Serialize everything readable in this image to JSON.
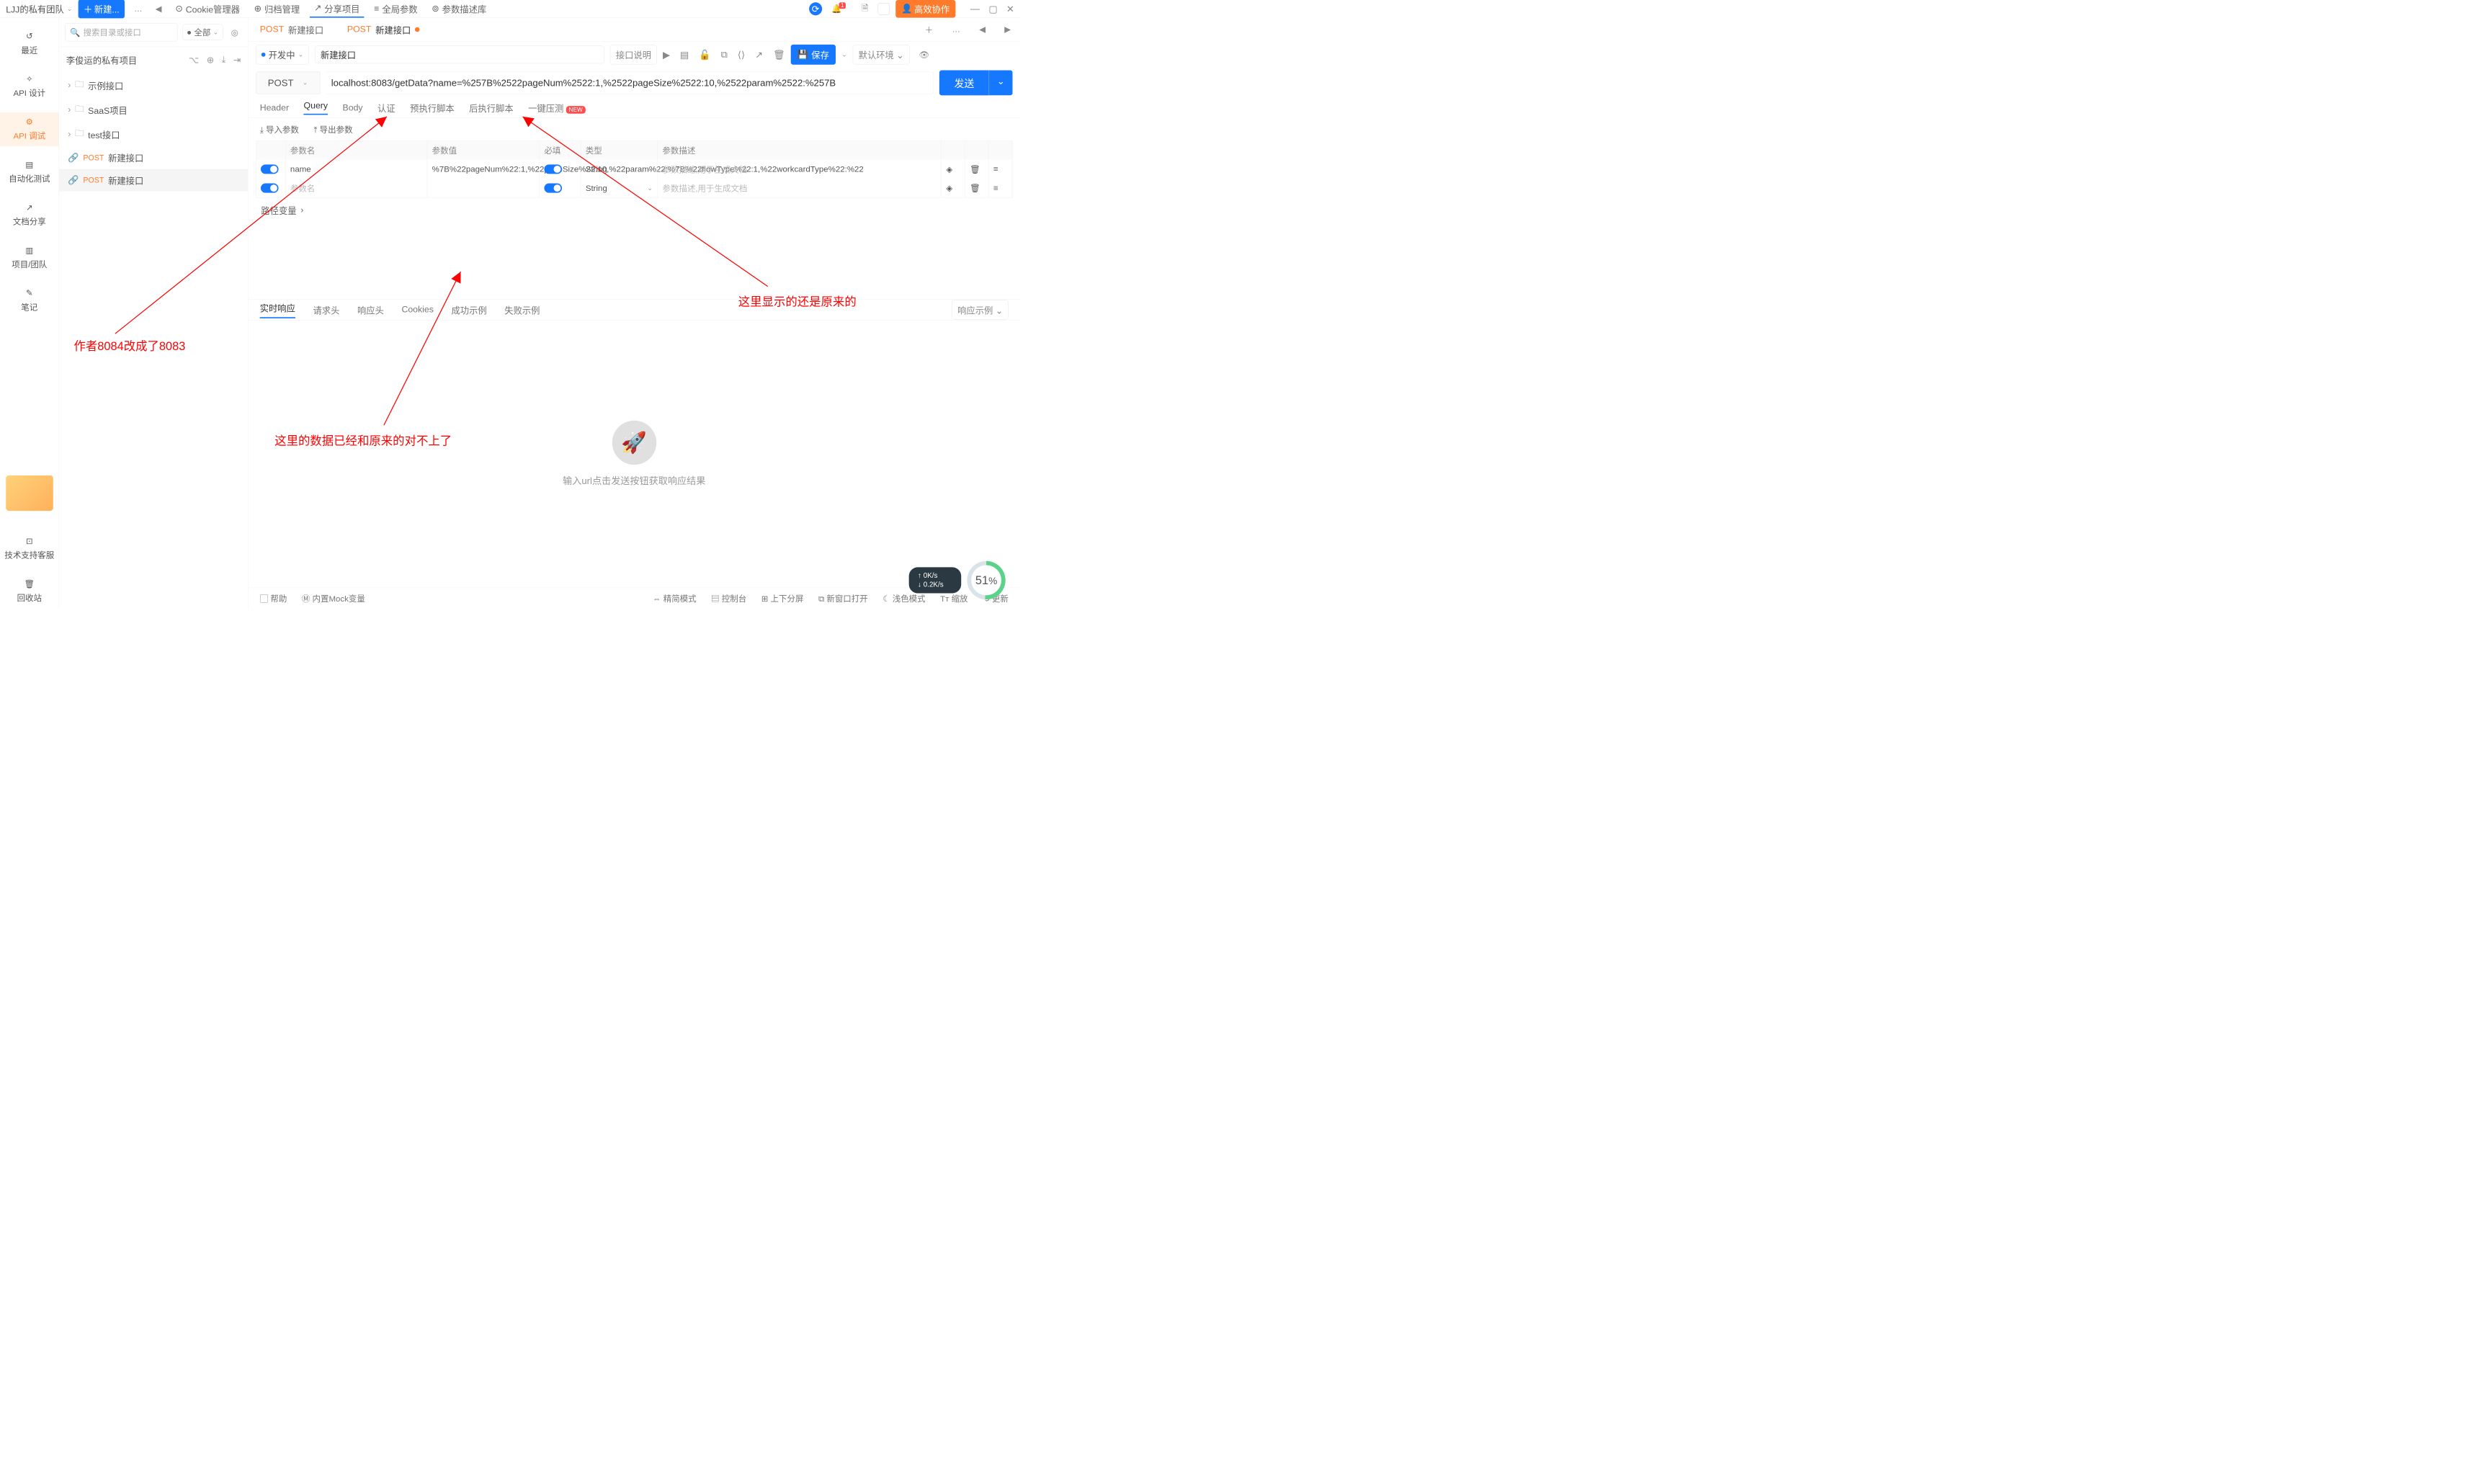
{
  "titlebar": {
    "team": "LJJ的私有团队",
    "new_btn": "新建...",
    "nav": [
      {
        "icon": "⊙",
        "label": "Cookie管理器"
      },
      {
        "icon": "⊕",
        "label": "归档管理"
      },
      {
        "icon": "↗",
        "label": "分享项目"
      },
      {
        "icon": "≡",
        "label": "全局参数"
      },
      {
        "icon": "⊚",
        "label": "参数描述库"
      }
    ],
    "collab": "高效协作",
    "badge": "1"
  },
  "rail": [
    {
      "icon": "↺",
      "label": "最近"
    },
    {
      "icon": "✧",
      "label": "API 设计"
    },
    {
      "icon": "⚙",
      "label": "API 调试"
    },
    {
      "icon": "▤",
      "label": "自动化测试"
    },
    {
      "icon": "↗",
      "label": "文档分享"
    },
    {
      "icon": "▥",
      "label": "项目/团队"
    },
    {
      "icon": "✎",
      "label": "笔记"
    }
  ],
  "rail_bottom": [
    {
      "icon": "⊡",
      "label": "技术支持客服"
    },
    {
      "icon": "🗑",
      "label": "回收站"
    }
  ],
  "tree": {
    "search_ph": "搜索目录或接口",
    "filter": "全部",
    "title": "李俊运的私有项目",
    "nodes": [
      {
        "t": "folder",
        "label": "示例接口"
      },
      {
        "t": "folder",
        "label": "SaaS项目"
      },
      {
        "t": "folder",
        "label": "test接口"
      },
      {
        "t": "api",
        "method": "POST",
        "label": "新建接口"
      },
      {
        "t": "api",
        "method": "POST",
        "label": "新建接口",
        "sel": true
      }
    ]
  },
  "tabs": [
    {
      "method": "POST",
      "label": "新建接口"
    },
    {
      "method": "POST",
      "label": "新建接口",
      "sel": true,
      "dirty": true
    }
  ],
  "info": {
    "status": "开发中",
    "name": "新建接口",
    "desc_btn": "接口说明",
    "save": "保存",
    "env": "默认环境"
  },
  "request": {
    "method": "POST",
    "url": "localhost:8083/getData?name=%257B%2522pageNum%2522:1,%2522pageSize%2522:10,%2522param%2522:%257B",
    "send": "发送"
  },
  "subtabs": [
    "Header",
    "Query",
    "Body",
    "认证",
    "预执行脚本",
    "后执行脚本",
    "一键压测"
  ],
  "subtab_sel": 1,
  "param_tools": {
    "import": "导入参数",
    "export": "导出参数"
  },
  "headers": [
    "",
    "参数名",
    "参数值",
    "必填",
    "类型",
    "参数描述",
    "",
    "",
    ""
  ],
  "rows": [
    {
      "on": true,
      "name": "name",
      "value": "%7B%22pageNum%22:1,%22pageSize%22:10,%22param%22:%7B%22flowType%22:1,%22workcardType%22:%22",
      "req": true,
      "type": "String",
      "desc_ph": "参数描述,用于生成文档"
    },
    {
      "on": true,
      "name_ph": "参数名",
      "value": "",
      "req": true,
      "type": "String",
      "desc_ph": "参数描述,用于生成文档"
    }
  ],
  "pathvar": "路径变量",
  "resp_tabs": [
    "实时响应",
    "请求头",
    "响应头",
    "Cookies",
    "成功示例",
    "失败示例"
  ],
  "resp_right": "响应示例",
  "empty_resp": "输入url点击发送按钮获取响应结果",
  "footer_l": [
    [
      "▢",
      "帮助"
    ],
    [
      "Ⓜ",
      "内置Mock变量"
    ]
  ],
  "footer_r": [
    [
      "⇔",
      "精简模式"
    ],
    [
      "▤",
      "控制台"
    ],
    [
      "⊞",
      "上下分屏"
    ],
    [
      "⧉",
      "新窗口打开"
    ],
    [
      "☾",
      "浅色模式"
    ],
    [
      "Tт",
      "缩放"
    ],
    [
      "⟲",
      "更新"
    ]
  ],
  "annotations": {
    "a1": "作者8084改成了8083",
    "a2": "这里的数据已经和原来的对不上了",
    "a3": "这里显示的还是原来的"
  },
  "speed": {
    "up": "0K/s",
    "down": "0.2K/s",
    "pct": "51"
  }
}
